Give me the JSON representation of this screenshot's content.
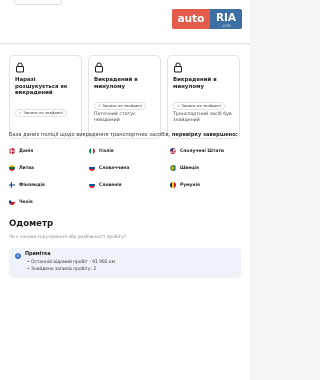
{
  "header": {
    "logo_auto": "auto",
    "logo_ria": "RIA",
    "logo_sub": ".COM"
  },
  "status_cards": [
    {
      "title": "Наразі розшукується як викрадений",
      "badge": "✓ Записи не знайдені",
      "desc": ""
    },
    {
      "title": "Викрадений в минулому",
      "badge": "✓ Записи не знайдені",
      "desc": "Поточний статус невідомий"
    },
    {
      "title": "Викрадений в минулому",
      "badge": "✓ Записи не знайдені",
      "desc": "Транспортний засіб був знайдений"
    }
  ],
  "database": {
    "text": "База даних поліції щодо викрадення транспортних засобів,",
    "bold": "перевірку завершено:"
  },
  "countries": [
    {
      "name": "Данія"
    },
    {
      "name": "Італія"
    },
    {
      "name": "Сполучені Штати"
    },
    {
      "name": "Литва"
    },
    {
      "name": "Словаччина"
    },
    {
      "name": "Швеція"
    },
    {
      "name": "Фінляндія"
    },
    {
      "name": "Словенія"
    },
    {
      "name": "Румунія"
    },
    {
      "name": "Чехія"
    }
  ],
  "odometer": {
    "title": "Одометр",
    "subtitle": "Чи є ознаки скручування або розбіжності пробігу?",
    "note_title": "Примітка",
    "items": [
      "Останній відомий пробіг - 91 992 км",
      "Знайдено записів пробігу: 2"
    ]
  },
  "colors": {
    "logo_red": "#e25b4b",
    "logo_blue": "#3c6fa4",
    "note_bg": "#eef3fa",
    "info_blue": "#3c74c5"
  }
}
